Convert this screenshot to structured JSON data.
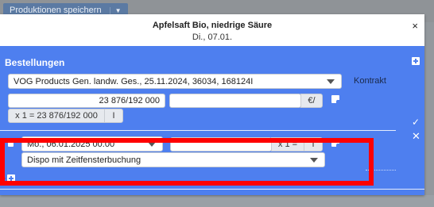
{
  "background": {
    "save_button_label": "Produktionen speichern"
  },
  "modal": {
    "title": "Apfelsaft Bio, niedrige Säure",
    "subtitle": "Di., 07.01.",
    "close_symbol": "×"
  },
  "orders": {
    "section_title": "Bestellungen",
    "supplier_select_value": "VOG Products Gen. landw. Ges., 25.11.2024, 36034, 168124I",
    "contract_label": "Kontrakt",
    "quantity_value": "23 876/192 000",
    "price_value": "",
    "price_unit": "€/",
    "multiplier_text": "x 1 = 23 876/192 000",
    "multiplier_tail": "I"
  },
  "delivery": {
    "date_select_value": "Mo., 06.01.2025 00:00",
    "amount_value": "",
    "multiplier_label": "x 1 =",
    "multiplier_tail": "I",
    "dispo_select_value": "Dispo mit Zeitfensterbuchung"
  },
  "colors": {
    "panel_blue": "#4e7fef",
    "highlight_red": "#ff0000"
  },
  "icons": {
    "close": "close-icon",
    "add": "plus-square-icon",
    "note": "note-icon",
    "delete": "trash-icon",
    "confirm": "check-icon",
    "cancel": "x-icon"
  }
}
